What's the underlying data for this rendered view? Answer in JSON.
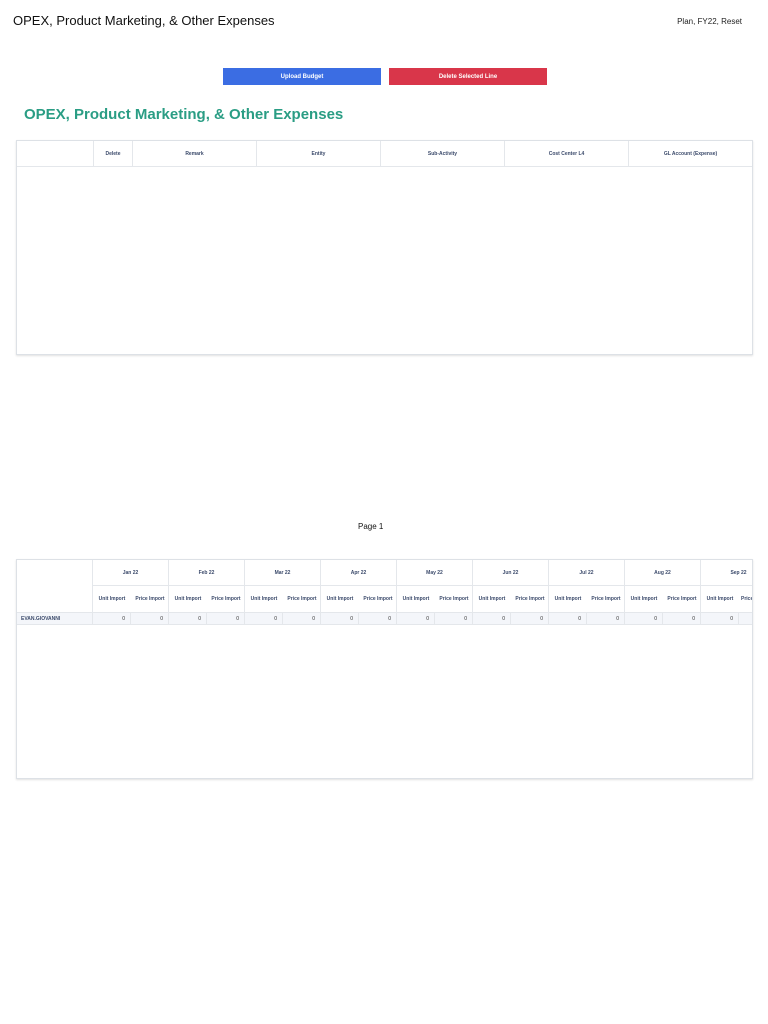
{
  "header": {
    "title": "OPEX, Product Marketing, & Other Expenses",
    "context": "Plan, FY22, Reset"
  },
  "toolbar": {
    "upload_label": "Upload Budget",
    "delete_label": "Delete Selected Line"
  },
  "section": {
    "title": "OPEX, Product Marketing, & Other Expenses"
  },
  "top_table": {
    "columns": [
      "",
      "Delete",
      "Remark",
      "Entity",
      "Sub-Activity",
      "Cost Center L4",
      "GL Account (Expense)"
    ]
  },
  "pagination": {
    "page_label": "Page 1"
  },
  "bottom_table": {
    "months": [
      "Jan 22",
      "Feb 22",
      "Mar 22",
      "Apr 22",
      "May 22",
      "Jun 22",
      "Jul 22",
      "Aug 22",
      "Sep 22"
    ],
    "sub_headers": [
      "Unit Import",
      "Price Import"
    ],
    "last_partial_sub": "Price",
    "rows": [
      {
        "label": "EVAN.GIOVANNI",
        "values": [
          "0",
          "0",
          "0",
          "0",
          "0",
          "0",
          "0",
          "0",
          "0",
          "0",
          "0",
          "0",
          "0",
          "0",
          "0",
          "0",
          "0"
        ]
      }
    ]
  },
  "colors": {
    "accent_blue": "#3b6de3",
    "accent_red": "#d9364a",
    "title_green": "#2a9d84",
    "header_text": "#3b4a6b"
  }
}
